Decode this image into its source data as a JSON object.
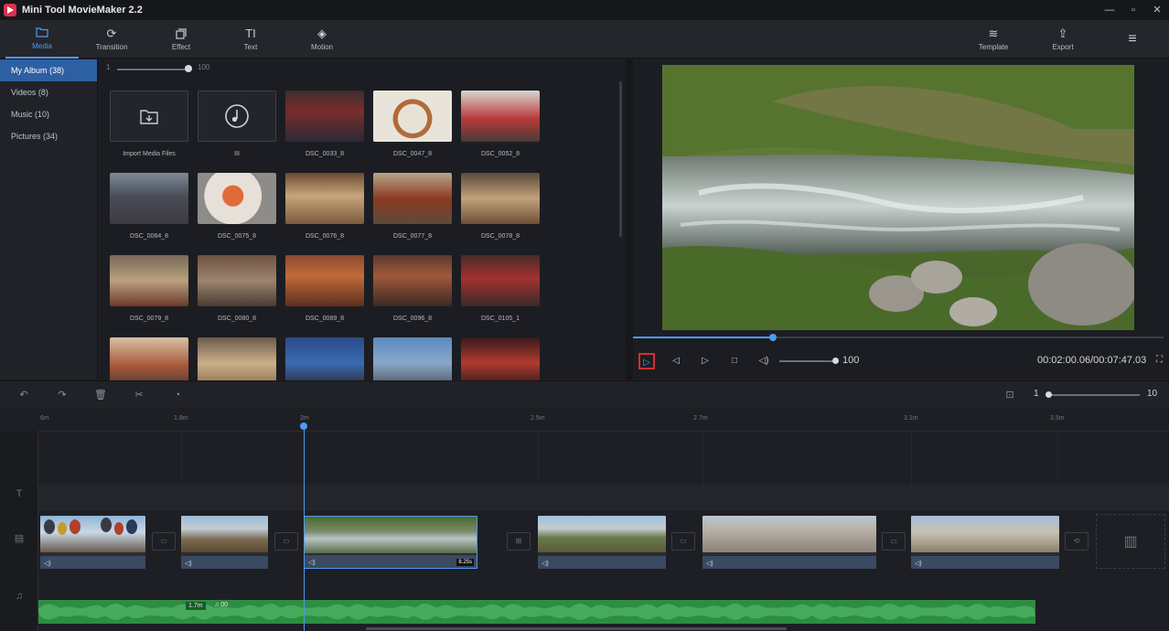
{
  "app": {
    "title": "Mini Tool MovieMaker 2.2"
  },
  "window_controls": {
    "minimize": "—",
    "maximize": "▫",
    "close": "✕"
  },
  "toolbar": {
    "tabs": [
      {
        "label": "Media",
        "icon": "folder-icon",
        "active": true
      },
      {
        "label": "Transition",
        "icon": "transition-icon",
        "active": false
      },
      {
        "label": "Effect",
        "icon": "effect-icon",
        "active": false
      },
      {
        "label": "Text",
        "icon": "text-icon",
        "active": false
      },
      {
        "label": "Motion",
        "icon": "motion-icon",
        "active": false
      }
    ],
    "template_label": "Template",
    "export_label": "Export"
  },
  "categories": [
    {
      "label": "My Album  (38)",
      "active": true
    },
    {
      "label": "Videos  (8)",
      "active": false
    },
    {
      "label": "Music  (10)",
      "active": false
    },
    {
      "label": "Pictures  (34)",
      "active": false
    }
  ],
  "media_zoom": {
    "min": "1",
    "max": "100"
  },
  "media": {
    "import_label": "Import Media Files",
    "music_label": "III",
    "items": [
      "DSC_0033_8",
      "DSC_0047_8",
      "DSC_0052_8",
      "DSC_0064_8",
      "DSC_0075_8",
      "DSC_0076_8",
      "DSC_0077_8",
      "DSC_0078_8",
      "DSC_0079_8",
      "DSC_0080_8",
      "DSC_0089_8",
      "DSC_0096_8",
      "DSC_0105_1"
    ]
  },
  "preview": {
    "progress_fraction": 0.263,
    "volume": "100",
    "timecode": "00:02:00.06/00:07:47.03",
    "fullscreen_icon": "⛶"
  },
  "timeline_zoom": {
    "min": "1",
    "max": "10"
  },
  "ruler_labels": [
    "6m",
    "1.8m",
    "2m",
    "2.5m",
    "2.7m",
    "3.1m",
    "3.5m"
  ],
  "clips": {
    "selected_duration": "8.25s"
  },
  "audio": {
    "badge": "1.7m",
    "volume_label": "♫ 00"
  },
  "colors": {
    "accent": "#4e9bf3",
    "audio_green": "#2f8c43",
    "highlight_red": "#d32f2f"
  }
}
